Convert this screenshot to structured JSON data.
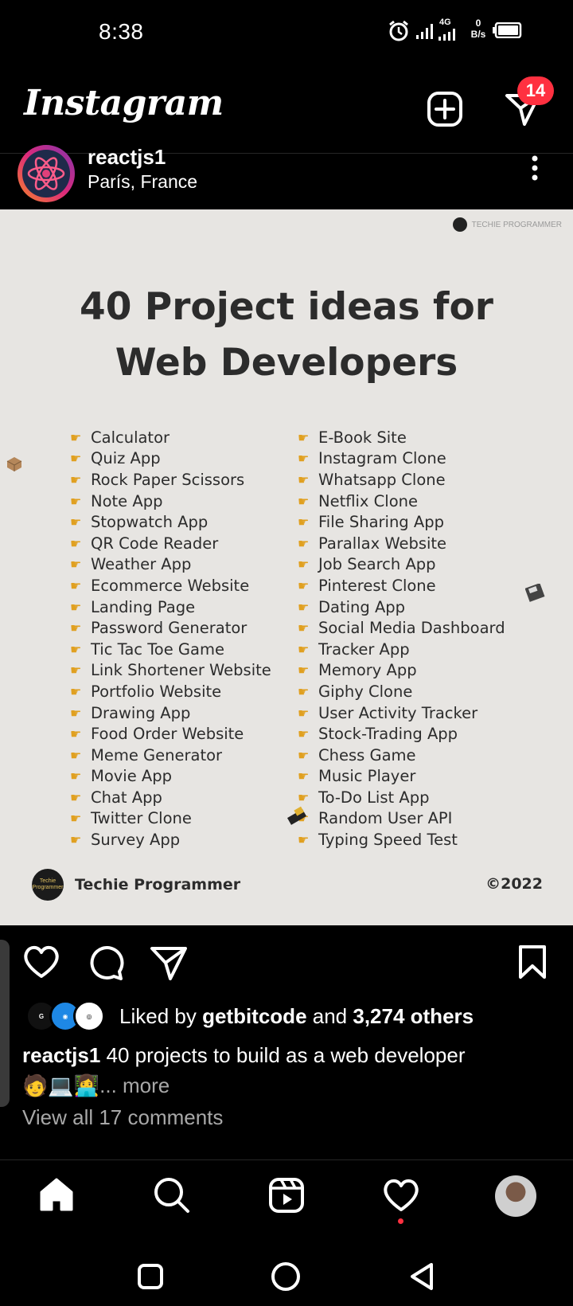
{
  "status_bar": {
    "time": "8:38",
    "network": "4G",
    "speed_value": "0",
    "speed_unit": "B/s"
  },
  "header": {
    "app_title": "Instagram",
    "notification_count": "14",
    "new_post_icon": "plus-square-icon",
    "messages_icon": "paper-plane-icon"
  },
  "post": {
    "username": "reactjs1",
    "location": "París, France",
    "menu_icon": "more-vertical-icon",
    "image": {
      "watermark": "TECHIE PROGRAMMER",
      "title_line1": "40 Project ideas for",
      "title_line2": "Web Developers",
      "left_column": [
        "Calculator",
        "Quiz App",
        "Rock Paper Scissors",
        "Note App",
        "Stopwatch App",
        "QR Code Reader",
        "Weather App",
        "Ecommerce Website",
        "Landing Page",
        "Password Generator",
        "Tic Tac Toe Game",
        "Link Shortener Website",
        "Portfolio Website",
        "Drawing App",
        "Food Order Website",
        "Meme Generator",
        "Movie App",
        "Chat App",
        "Twitter Clone",
        "Survey App"
      ],
      "right_column": [
        "E-Book Site",
        "Instagram Clone",
        "Whatsapp Clone",
        "Netflix Clone",
        "File Sharing App",
        "Parallax Website",
        "Job Search App",
        "Pinterest Clone",
        "Dating App",
        "Social Media Dashboard",
        "Tracker App",
        "Memory App",
        "Giphy Clone",
        "User Activity Tracker",
        "Stock-Trading App",
        "Chess Game",
        "Music Player",
        "To-Do List App",
        "Random User API",
        "Typing Speed Test"
      ],
      "brand_logo_text": "Techie Programmer",
      "brand_name": "Techie Programmer",
      "copyright": "©2022"
    },
    "likes": {
      "prefix": "Liked by ",
      "user": "getbitcode",
      "middle": " and ",
      "others": "3,274 others"
    },
    "caption": {
      "username": "reactjs1",
      "text": " 40 projects to build as a web developer",
      "emojis": "🧑💻👩‍💻",
      "more": "... more"
    },
    "comments_link": "View all 17 comments"
  },
  "bottom_nav": {
    "items": [
      "home-icon",
      "search-icon",
      "reels-icon",
      "heart-icon",
      "profile-avatar"
    ]
  },
  "colors": {
    "background": "#000000",
    "post_bg": "#e7e5e2",
    "post_text": "#2c2c2c",
    "badge": "#ff3040",
    "muted_text": "#a8a8a8"
  }
}
